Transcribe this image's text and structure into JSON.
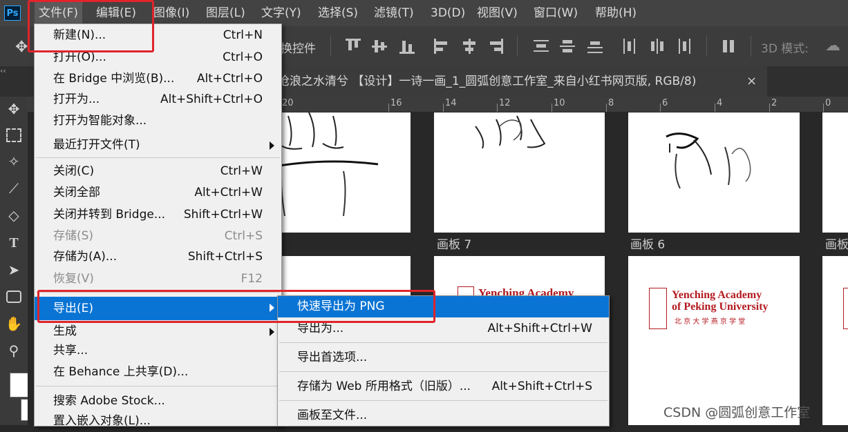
{
  "app": {
    "logo": "Ps"
  },
  "menubar": {
    "items": [
      "文件(F)",
      "编辑(E)",
      "图像(I)",
      "图层(L)",
      "文字(Y)",
      "选择(S)",
      "滤镜(T)",
      "3D(D)",
      "视图(V)",
      "窗口(W)",
      "帮助(H)"
    ]
  },
  "options_bar": {
    "transform_label": "换控件",
    "mode_3d_label": "3D 模式:"
  },
  "document": {
    "title": "沧浪之水清兮 【设计】一诗一画_1_圆弧创意工作室_来自小红书网页版, RGB/8)",
    "close_label": "×"
  },
  "ruler": {
    "ticks": [
      "20",
      "16",
      "14",
      "12",
      "10",
      "8",
      "6",
      "4",
      "2",
      "0"
    ]
  },
  "artboards": {
    "label_7": "画板 7",
    "label_6": "画板 6",
    "label_partial": "画板"
  },
  "yenching": {
    "line1": "Yenching Academy",
    "line2": "of Peking University",
    "line3": "北 京 大 学 燕 京 学 堂",
    "partial": "Yenching Academy"
  },
  "file_menu": {
    "items": [
      {
        "label": "新建(N)...",
        "shortcut": "Ctrl+N"
      },
      {
        "label": "打开(O)...",
        "shortcut": "Ctrl+O"
      },
      {
        "label": "在 Bridge 中浏览(B)...",
        "shortcut": "Alt+Ctrl+O"
      },
      {
        "label": "打开为...",
        "shortcut": "Alt+Shift+Ctrl+O"
      },
      {
        "label": "打开为智能对象...",
        "shortcut": ""
      },
      {
        "label": "最近打开文件(T)",
        "shortcut": ""
      },
      {
        "label": "关闭(C)",
        "shortcut": "Ctrl+W"
      },
      {
        "label": "关闭全部",
        "shortcut": "Alt+Ctrl+W"
      },
      {
        "label": "关闭并转到 Bridge...",
        "shortcut": "Shift+Ctrl+W"
      },
      {
        "label": "存储(S)",
        "shortcut": "Ctrl+S"
      },
      {
        "label": "存储为(A)...",
        "shortcut": "Shift+Ctrl+S"
      },
      {
        "label": "恢复(V)",
        "shortcut": "F12"
      },
      {
        "label": "导出(E)",
        "shortcut": ""
      },
      {
        "label": "生成",
        "shortcut": ""
      },
      {
        "label": "共享...",
        "shortcut": ""
      },
      {
        "label": "在 Behance 上共享(D)...",
        "shortcut": ""
      },
      {
        "label": "搜索 Adobe Stock...",
        "shortcut": ""
      },
      {
        "label": "置入嵌入对象(L)...",
        "shortcut": ""
      }
    ]
  },
  "export_submenu": {
    "items": [
      {
        "label": "快速导出为 PNG",
        "shortcut": ""
      },
      {
        "label": "导出为...",
        "shortcut": "Alt+Shift+Ctrl+W"
      },
      {
        "label": "导出首选项...",
        "shortcut": ""
      },
      {
        "label": "存储为 Web 所用格式（旧版）...",
        "shortcut": "Alt+Shift+Ctrl+S"
      },
      {
        "label": "画板至文件...",
        "shortcut": ""
      }
    ]
  },
  "watermark": "CSDN @圆弧创意工作室",
  "colors": {
    "menu_highlight": "#0a74d4",
    "annotation_red": "#e0242a",
    "panel_bg": "#3c3c3c"
  }
}
